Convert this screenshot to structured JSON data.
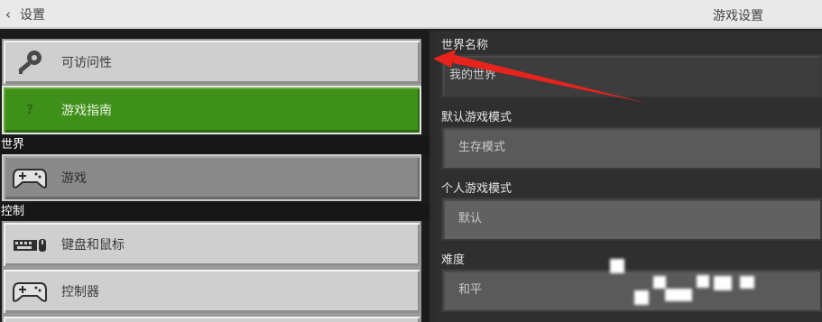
{
  "titlebar": {
    "back_label": "设置",
    "page_title": "游戏设置"
  },
  "left": {
    "items_top": [
      {
        "label": "可访问性",
        "icon": "key-icon"
      },
      {
        "label": "游戏指南",
        "icon": "question-icon",
        "icon_text": "?"
      }
    ],
    "section_world": "世界",
    "items_world": [
      {
        "label": "游戏",
        "icon": "controller-icon"
      }
    ],
    "section_controls": "控制",
    "items_controls": [
      {
        "label": "键盘和鼠标",
        "icon": "keyboard-mouse-icon"
      },
      {
        "label": "控制器",
        "icon": "controller-icon"
      }
    ]
  },
  "right": {
    "world_name_label": "世界名称",
    "world_name_value": "我的世界",
    "default_mode_label": "默认游戏模式",
    "default_mode_value": "生存模式",
    "personal_mode_label": "个人游戏模式",
    "personal_mode_value": "默认",
    "difficulty_label": "难度",
    "difficulty_value": "和平"
  },
  "colors": {
    "active_green": "#3f8f1b",
    "button_gray": "#cfcfcf",
    "annotation_red": "#e8231c"
  }
}
